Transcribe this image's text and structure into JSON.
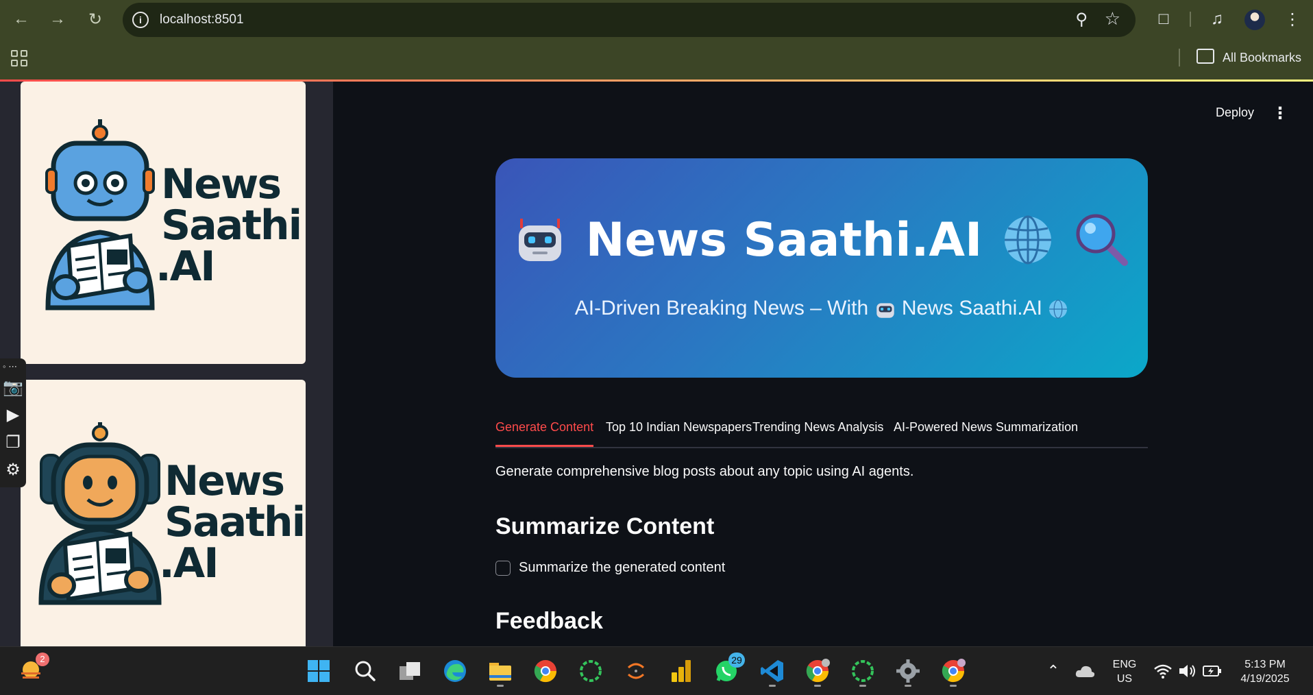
{
  "browser": {
    "url": "localhost:8501",
    "bookmarks_label": "All Bookmarks"
  },
  "sidebar": {
    "logo1": {
      "line1": "News",
      "line2": "Saathi",
      "line3": ".AI"
    },
    "logo2": {
      "line1": "News",
      "line2": "Saathi",
      "line3": ".AI"
    }
  },
  "app_header": {
    "deploy_label": "Deploy"
  },
  "hero": {
    "title": "News Saathi.AI",
    "subtitle_prefix": "AI-Driven Breaking News – With",
    "subtitle_suffix": "News Saathi.AI"
  },
  "tabs": [
    {
      "label": "Generate Content",
      "active": true
    },
    {
      "label": "Top 10 Indian Newspapers",
      "active": false
    },
    {
      "label": "Trending News Analysis",
      "active": false
    },
    {
      "label": "AI-Powered News Summarization",
      "active": false
    }
  ],
  "main": {
    "description": "Generate comprehensive blog posts about any topic using AI agents.",
    "summarize_heading": "Summarize Content",
    "summarize_checkbox_label": "Summarize the generated content",
    "summarize_checked": false,
    "feedback_heading": "Feedback"
  },
  "taskbar": {
    "weather_badge": "2",
    "whatsapp_badge": "29",
    "lang_line1": "ENG",
    "lang_line2": "US",
    "time": "5:13 PM",
    "date": "4/19/2025"
  },
  "colors": {
    "accent": "#ff4b4b",
    "sidebar_bg": "#262730",
    "main_bg": "#0e1117",
    "hero_start": "#3a55b8",
    "hero_end": "#0ba8c9"
  }
}
